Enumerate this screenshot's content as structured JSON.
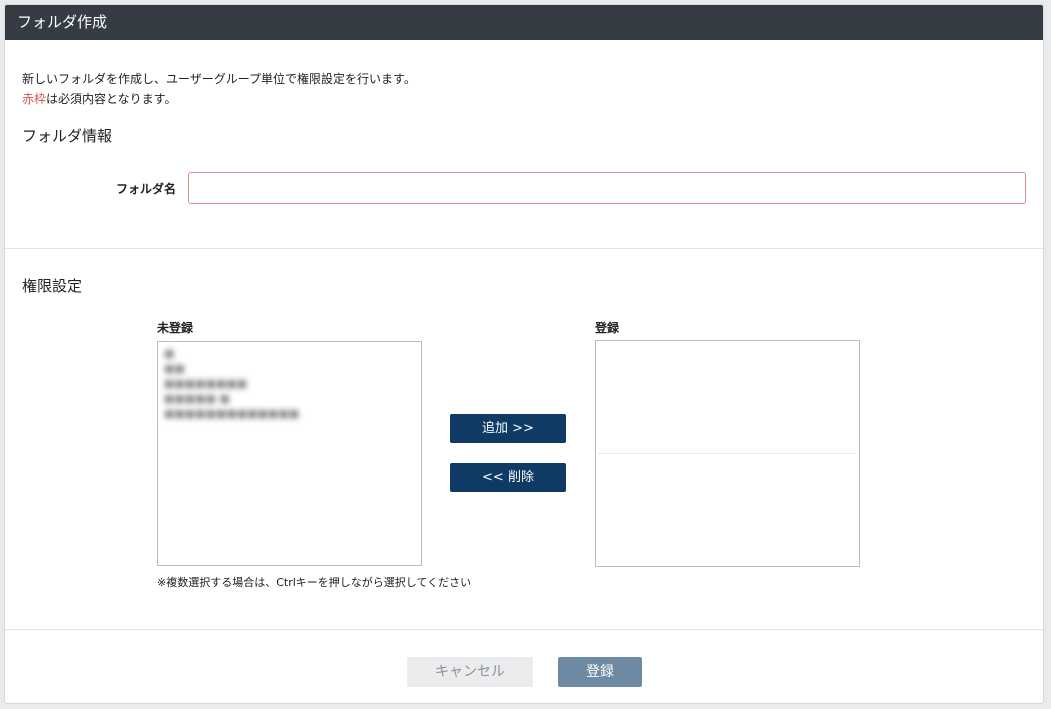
{
  "dialog": {
    "title": "フォルダ作成",
    "description_line1": "新しいフォルダを作成し、ユーザーグループ単位で権限設定を行います。",
    "required_red": "赤枠",
    "required_rest": "は必須内容となります。"
  },
  "folder_info": {
    "section_title": "フォルダ情報",
    "folder_name_label": "フォルダ名",
    "folder_name_value": ""
  },
  "permissions": {
    "section_title": "権限設定",
    "unregistered_label": "未登録",
    "unregistered_items": [
      "■",
      "■■",
      "■■■■■■■■",
      "■■■■■ ■",
      "■■■■■■■■■■■■■"
    ],
    "registered_label": "登録",
    "add_button": "追加 >>",
    "remove_button": "<< 削除",
    "note": "※複数選択する場合は、Ctrlキーを押しながら選択してください"
  },
  "footer": {
    "cancel_button": "キャンセル",
    "submit_button": "登録"
  }
}
